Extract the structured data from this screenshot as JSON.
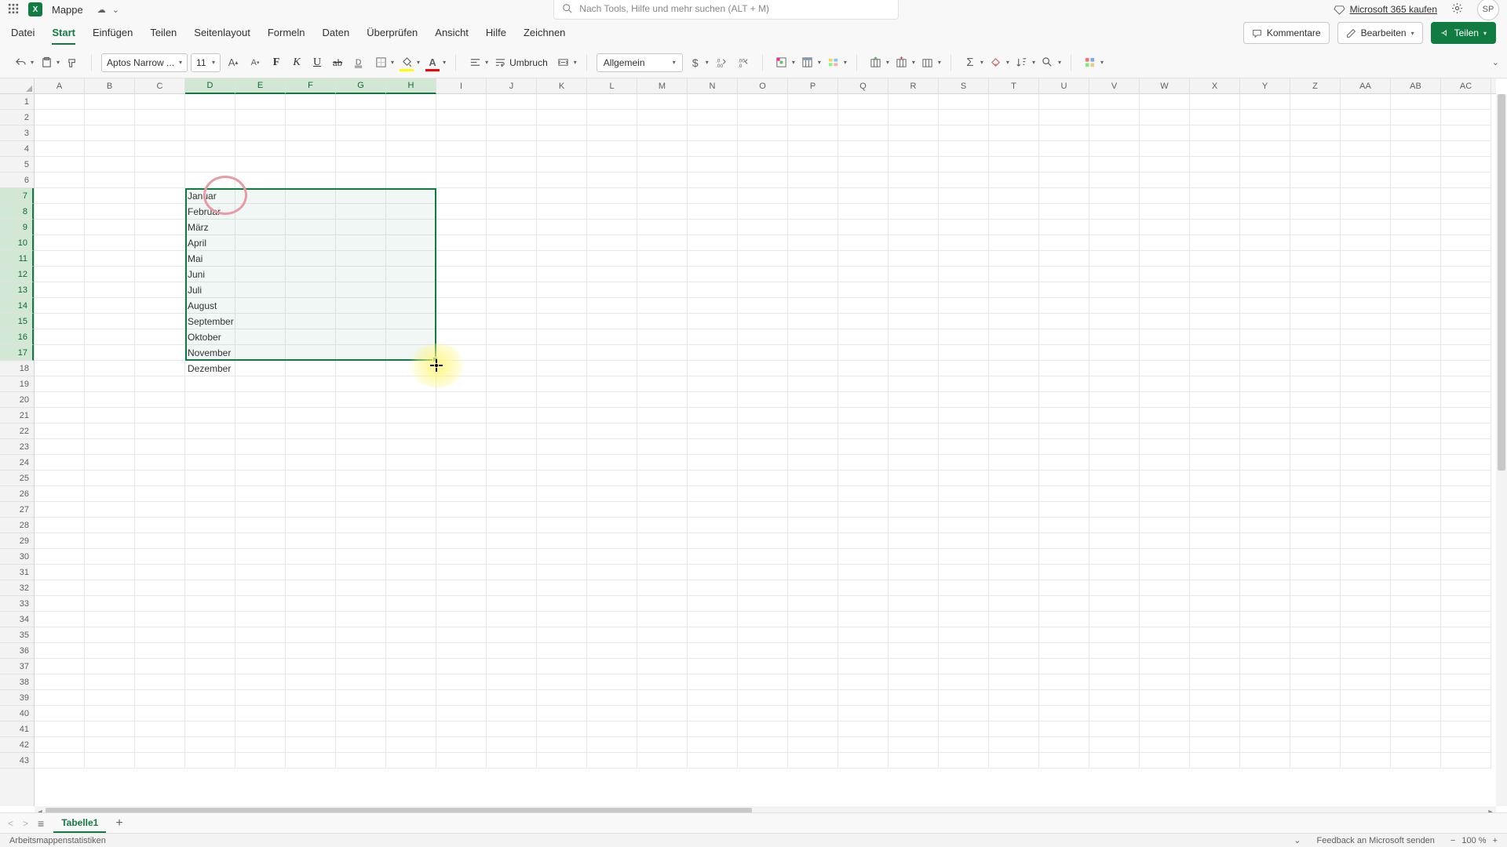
{
  "titlebar": {
    "doc_name": "Mappe",
    "search_placeholder": "Nach Tools, Hilfe und mehr suchen (ALT + M)",
    "m365_link": "Microsoft 365 kaufen",
    "avatar": "SP"
  },
  "menu": {
    "items": [
      "Datei",
      "Start",
      "Einfügen",
      "Teilen",
      "Seitenlayout",
      "Formeln",
      "Daten",
      "Überprüfen",
      "Ansicht",
      "Hilfe",
      "Zeichnen"
    ],
    "active_index": 1,
    "comments": "Kommentare",
    "edit": "Bearbeiten",
    "share": "Teilen"
  },
  "ribbon": {
    "font_name": "Aptos Narrow ...",
    "font_size": "11",
    "bold": "F",
    "italic": "K",
    "underline": "U",
    "strike": "ab",
    "wrap": "Umbruch",
    "number_format": "Allgemein"
  },
  "columns": [
    "A",
    "B",
    "C",
    "D",
    "E",
    "F",
    "G",
    "H",
    "I",
    "J",
    "K",
    "L",
    "M",
    "N",
    "O",
    "P",
    "Q",
    "R",
    "S",
    "T",
    "U",
    "V",
    "W",
    "X",
    "Y",
    "Z",
    "AA",
    "AB",
    "AC"
  ],
  "selected_cols": [
    "D",
    "E",
    "F",
    "G",
    "H"
  ],
  "selected_rows": [
    7,
    8,
    9,
    10,
    11,
    12,
    13,
    14,
    15,
    16,
    17
  ],
  "row_count": 43,
  "cells": {
    "D7": "Januar",
    "D8": "Februar",
    "D9": "März",
    "D10": "April",
    "D11": "Mai",
    "D12": "Juni",
    "D13": "Juli",
    "D14": "August",
    "D15": "September",
    "D16": "Oktober",
    "D17": "November",
    "D18": "Dezember"
  },
  "sheets": {
    "active": "Tabelle1"
  },
  "status": {
    "left": "Arbeitsmappenstatistiken",
    "feedback": "Feedback an Microsoft senden",
    "zoom": "100 %"
  }
}
